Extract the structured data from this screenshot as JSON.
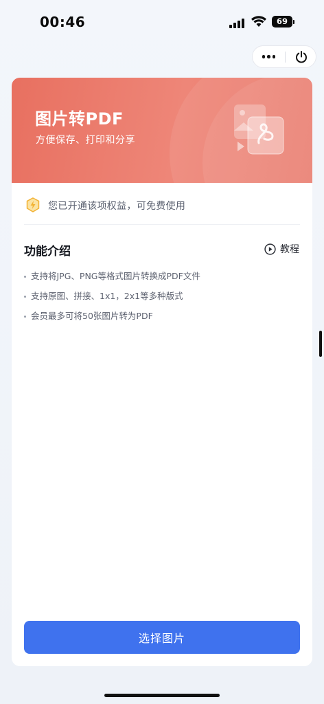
{
  "status_bar": {
    "time": "00:46",
    "battery_level": "69"
  },
  "capsule": {
    "more_icon": "more-dots-icon",
    "power_icon": "power-icon"
  },
  "banner": {
    "title": "图片转PDF",
    "subtitle": "方便保存、打印和分享",
    "icon": "image-to-pdf-icon",
    "gradient_colors": [
      "#e87060",
      "#ee8678"
    ]
  },
  "benefit": {
    "icon": "shield-bolt-icon",
    "text": "您已开通该项权益，可免费使用",
    "icon_color": "#f2b233"
  },
  "features": {
    "title": "功能介绍",
    "tutorial_label": "教程",
    "tutorial_icon": "play-circle-icon",
    "items": [
      "支持将JPG、PNG等格式图片转换成PDF文件",
      "支持原图、拼接、1x1，2x1等多种版式",
      "会员最多可将50张图片转为PDF"
    ]
  },
  "actions": {
    "select_label": "选择图片",
    "primary_color": "#3f72ee"
  }
}
